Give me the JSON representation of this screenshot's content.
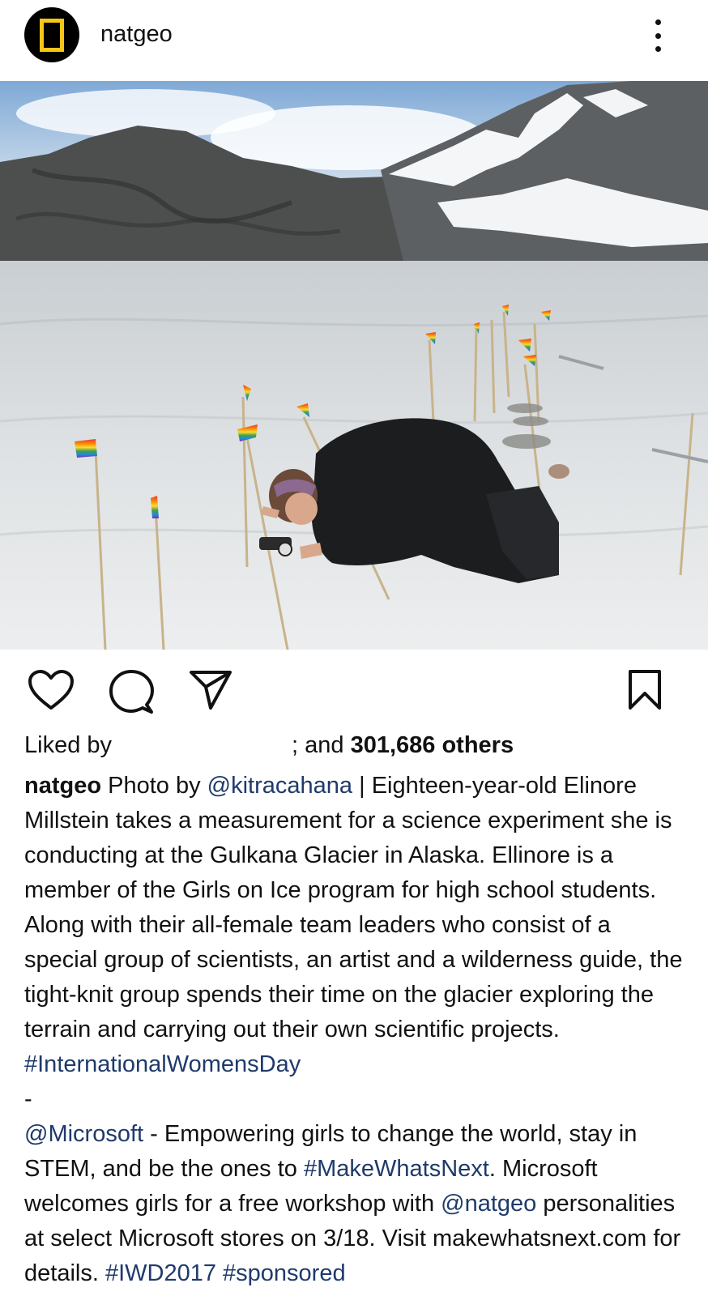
{
  "header": {
    "username": "natgeo",
    "avatar_icon": "natgeo-yellow-frame-logo",
    "more_icon": "vertical-ellipsis-icon"
  },
  "post": {
    "image_alt": "A student lying on glacier ice taking a measurement among small rainbow flags, mountains in background"
  },
  "actions": {
    "like_icon": "heart-outline-icon",
    "comment_icon": "comment-bubble-icon",
    "share_icon": "paper-plane-icon",
    "save_icon": "bookmark-outline-icon"
  },
  "likes": {
    "prefix": "Liked by",
    "suffix": "; and",
    "count_text": "301,686 others"
  },
  "caption": {
    "username": "natgeo",
    "part1": "Photo by",
    "mention1": "@kitracahana",
    "part2": "| Eighteen-year-old Elinore Millstein takes a measurement for a science experiment she is conducting at the Gulkana Glacier in Alaska. Ellinore is a member of the Girls on Ice program for high school students. Along with their all-female team leaders who consist of a special group of scientists, an artist and a wilderness guide, the tight-knit group spends their time on the glacier exploring the terrain and carrying out their own scientific projects.",
    "hashtag1": "#InternationalWomensDay",
    "separator": "-",
    "mention2": "@Microsoft",
    "part3": "- Empowering girls to change the world, stay in STEM, and be the ones to",
    "hashtag2": "#MakeWhatsNext",
    "part4": ". Microsoft welcomes girls for a free workshop with",
    "mention3": "@natgeo",
    "part5": "personalities at select Microsoft stores on 3/18. Visit makewhatsnext.com for details.",
    "hashtag3": "#IWD2017",
    "hashtag4": "#sponsored"
  },
  "colors": {
    "link": "#1f3a6b",
    "logo_yellow": "#f5c518"
  }
}
